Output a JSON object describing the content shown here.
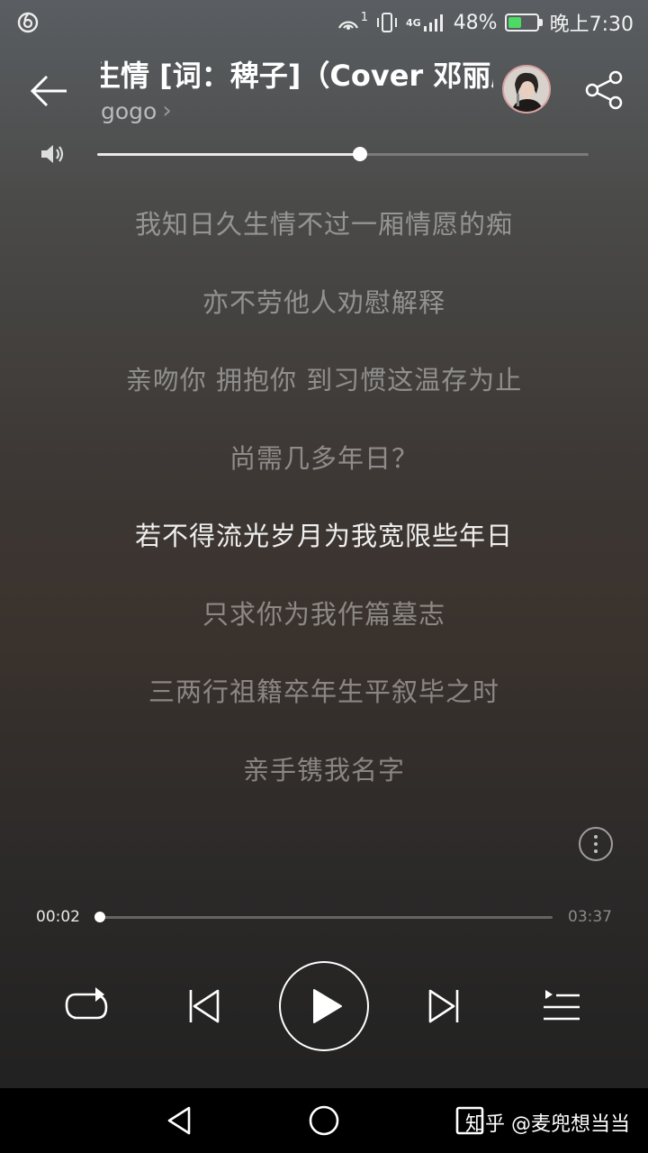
{
  "status_bar": {
    "signal_superscript": "1",
    "network_label": "4G",
    "battery_percent": "48%",
    "battery_level": 0.48,
    "clock": "晚上7:30"
  },
  "header": {
    "title": "生情 [词：稗子]（Cover 邓丽欣）",
    "artist": "gogo",
    "artist_chevron": "›"
  },
  "volume": {
    "level": 0.535
  },
  "lyrics": [
    {
      "text": "我知日久生情不过一厢情愿的痴",
      "current": false
    },
    {
      "text": "亦不劳他人劝慰解释",
      "current": false
    },
    {
      "text": "亲吻你 拥抱你 到习惯这温存为止",
      "current": false
    },
    {
      "text": "尚需几多年日？",
      "current": false
    },
    {
      "text": "若不得流光岁月为我宽限些年日",
      "current": true
    },
    {
      "text": "只求你为我作篇墓志",
      "current": false
    },
    {
      "text": "三两行祖籍卒年生平叙毕之时",
      "current": false
    },
    {
      "text": "亲手镌我名字",
      "current": false
    }
  ],
  "player": {
    "elapsed": "00:02",
    "total": "03:37",
    "progress": 0.0
  },
  "watermark": "知乎 @麦兜想当当",
  "icons": {
    "status": [
      "netease-music-icon",
      "hotspot-icon",
      "vibrate-icon",
      "signal-icon",
      "battery-icon"
    ],
    "header": [
      "back-arrow-icon",
      "share-icon"
    ],
    "controls": [
      "loop-icon",
      "previous-icon",
      "play-icon",
      "next-icon",
      "playlist-icon"
    ],
    "nav": [
      "nav-back-icon",
      "nav-home-icon",
      "nav-recents-icon"
    ]
  }
}
